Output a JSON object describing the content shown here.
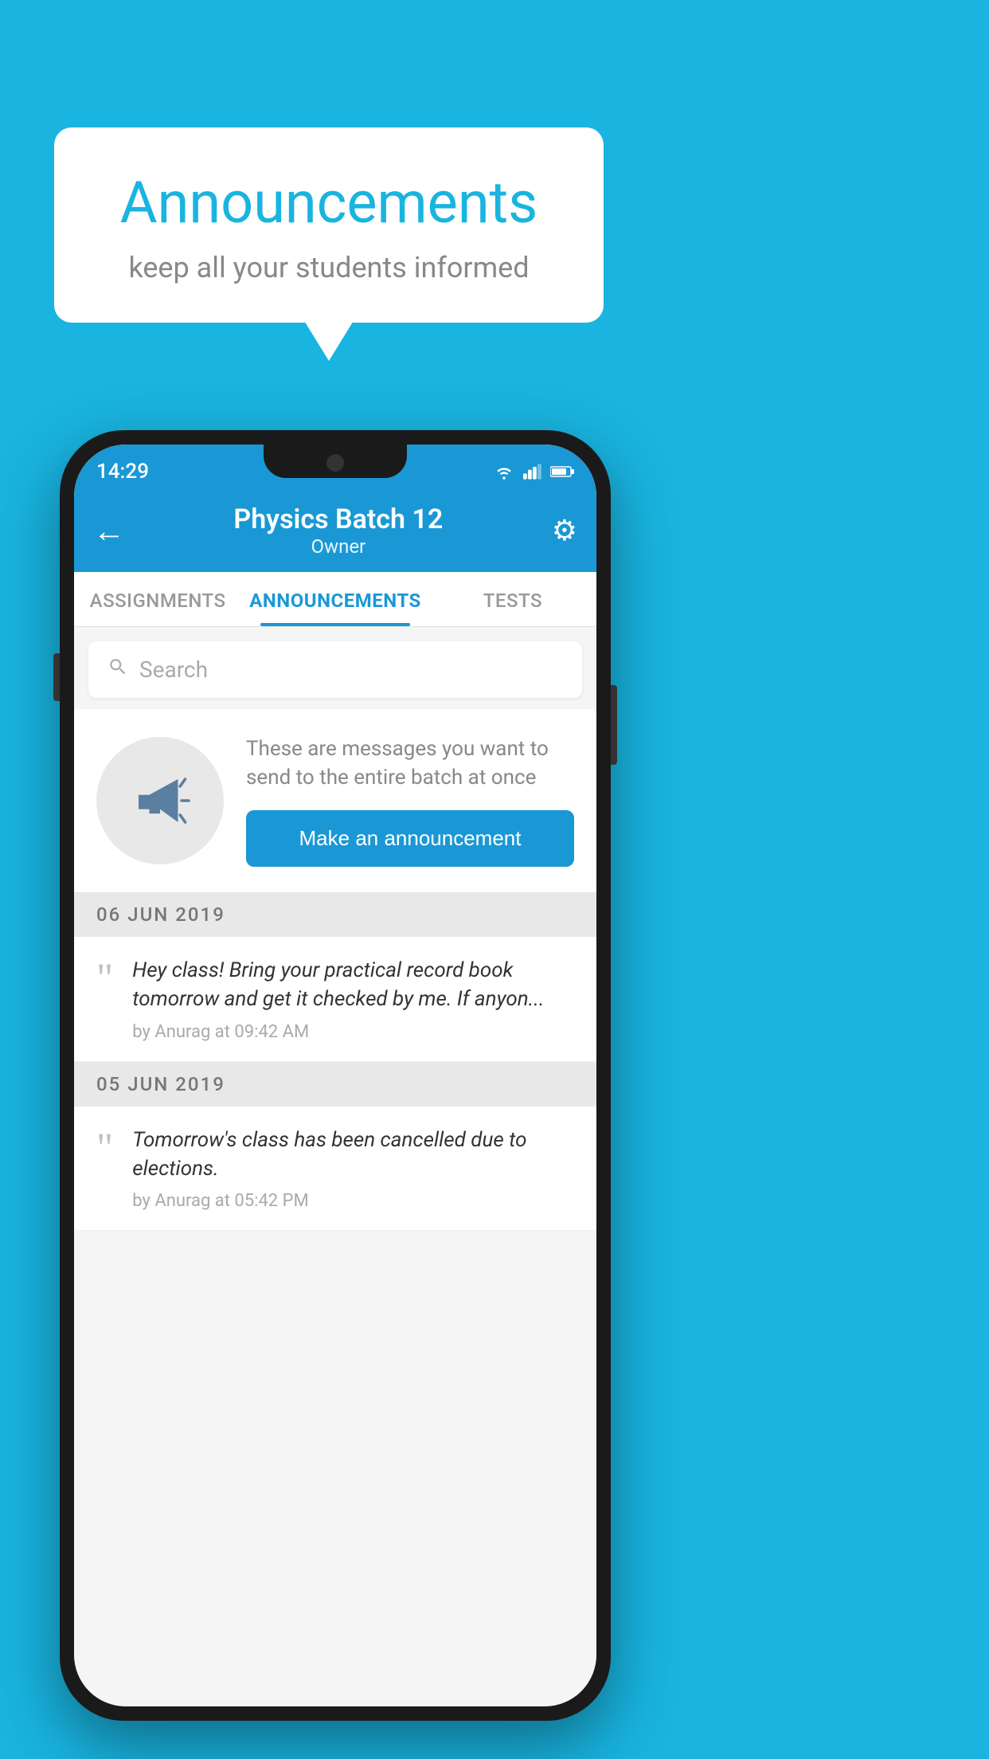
{
  "background_color": "#19b4e0",
  "speech_bubble": {
    "title": "Announcements",
    "subtitle": "keep all your students informed"
  },
  "phone": {
    "status_bar": {
      "time": "14:29"
    },
    "header": {
      "back_label": "←",
      "title": "Physics Batch 12",
      "subtitle": "Owner",
      "gear_label": "⚙"
    },
    "tabs": [
      {
        "label": "ASSIGNMENTS",
        "active": false
      },
      {
        "label": "ANNOUNCEMENTS",
        "active": true
      },
      {
        "label": "TESTS",
        "active": false
      }
    ],
    "search": {
      "placeholder": "Search"
    },
    "empty_state": {
      "description": "These are messages you want to send to the entire batch at once",
      "button_label": "Make an announcement"
    },
    "announcements": [
      {
        "date": "06  JUN  2019",
        "message": "Hey class! Bring your practical record book tomorrow and get it checked by me. If anyon...",
        "meta": "by Anurag at 09:42 AM"
      },
      {
        "date": "05  JUN  2019",
        "message": "Tomorrow's class has been cancelled due to elections.",
        "meta": "by Anurag at 05:42 PM"
      }
    ]
  }
}
